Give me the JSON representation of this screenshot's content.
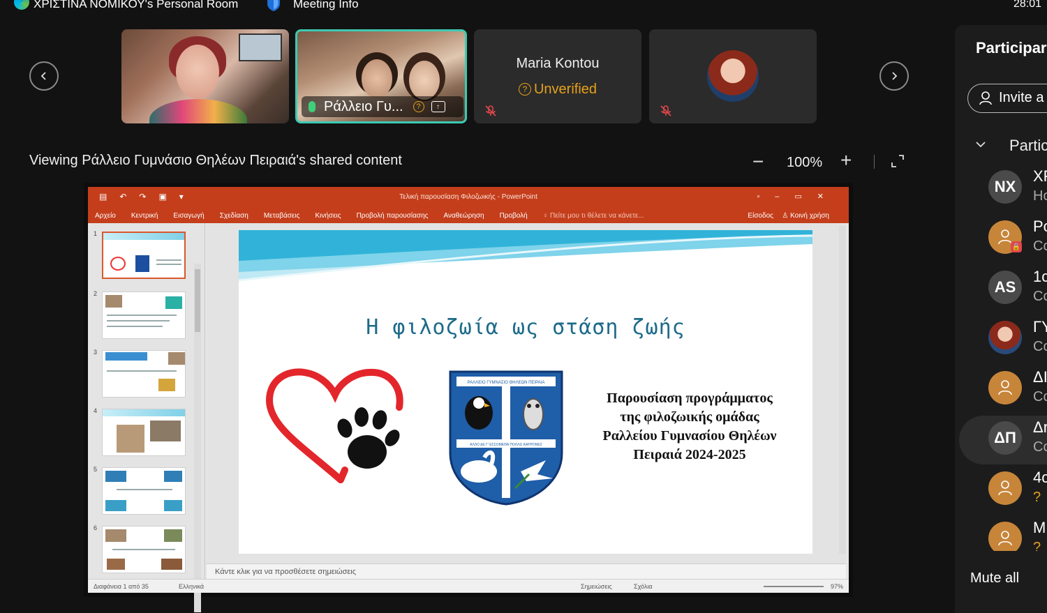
{
  "topbar": {
    "room_title": "ΧΡΙΣΤΙΝΑ ΝΟΜΙΚΟΥ's Personal Room",
    "meeting_info": "Meeting Info",
    "timer": "28:01"
  },
  "video_strip": {
    "tiles": [
      {
        "kind": "video"
      },
      {
        "kind": "video",
        "name": "Ράλλειο Γυ...",
        "active_speaker": true
      },
      {
        "kind": "placeholder",
        "name": "Maria Kontou",
        "status": "Unverified",
        "muted": true
      },
      {
        "kind": "avatar",
        "muted": true
      }
    ]
  },
  "viewing": {
    "label": "Viewing Ράλλειο Γυμνάσιο Θηλέων Πειραιά's shared content",
    "zoom": "100%"
  },
  "powerpoint": {
    "doc_title": "Τελική παρουσίαση Φιλοζωικής - PowerPoint",
    "ribbon_tabs": [
      "Αρχείο",
      "Κεντρική",
      "Εισαγωγή",
      "Σχεδίαση",
      "Μεταβάσεις",
      "Κινήσεις",
      "Προβολή παρουσίασης",
      "Αναθεώρηση",
      "Προβολή"
    ],
    "tell_me": "Πείτε μου τι θέλετε να κάνετε...",
    "sign_in": "Είσοδος",
    "share": "Κοινή χρήση",
    "thumb_numbers": [
      "1",
      "2",
      "3",
      "4",
      "5",
      "6"
    ],
    "slide": {
      "title": "Η φιλοζωία ως στάση ζωής",
      "crest_text_top": "ΡΑΛΛΕΙΟ ΓΥΜΝΑΣΙΟ ΘΗΛΕΩΝ ΠΕΙΡΑΙΑ",
      "crest_text_mid": "ΑΛΛΟ ΔΕ Γ' ΕΣΣΟΜΕΘΑ ΠΟΛΛΩ ΚΑΡΡΟΝΕΣ",
      "body_lines": [
        "Παρουσίαση προγράμματος",
        "της φιλοζωικής ομάδας",
        "Ραλλείου Γυμνασίου Θηλέων",
        "Πειραιά 2024-2025"
      ]
    },
    "notes_placeholder": "Κάντε κλικ για να προσθέσετε σημειώσεις",
    "status": {
      "slide_of": "Διαφάνεια 1 από 35",
      "language": "Ελληνικά",
      "notes": "Σημειώσεις",
      "comments": "Σχόλια",
      "zoom": "97%"
    }
  },
  "participants": {
    "title": "Participar",
    "invite": "Invite a",
    "section": "Partic",
    "rows": [
      {
        "initials": "NX",
        "name": "XF",
        "sub": "Ho",
        "style": "grey"
      },
      {
        "initials": "",
        "name": "Pc",
        "sub": "Co",
        "style": "orange",
        "lock": true
      },
      {
        "initials": "AS",
        "name": "1c",
        "sub": "Co",
        "style": "grey"
      },
      {
        "initials": "",
        "name": "ΓΥ",
        "sub": "Co",
        "style": "photo"
      },
      {
        "initials": "",
        "name": "ΔΙ",
        "sub": "Co",
        "style": "orange"
      },
      {
        "initials": "ΔΠ",
        "name": "Δr",
        "sub": "Co",
        "style": "grey",
        "selected": true
      },
      {
        "initials": "",
        "name": "4c",
        "sub": "?",
        "style": "orange",
        "warn": true
      },
      {
        "initials": "",
        "name": "M",
        "sub": "?",
        "style": "orange",
        "warn": true
      }
    ],
    "mute_all": "Mute all"
  },
  "colors": {
    "accent_teal": "#3ccbb3",
    "ppt_red": "#c43e1c",
    "warning": "#e6a11a",
    "muted_red": "#e0474c"
  }
}
